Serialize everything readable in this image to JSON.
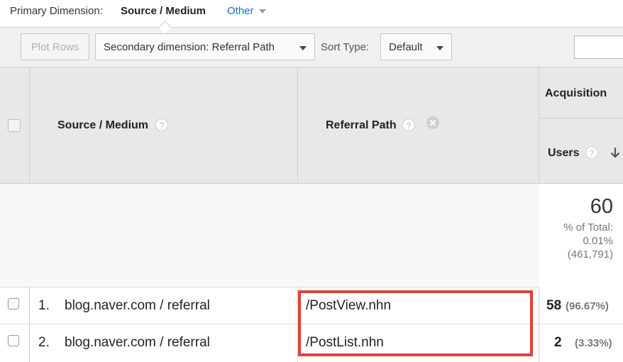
{
  "primary_dimension": {
    "label": "Primary Dimension:",
    "value": "Source / Medium",
    "other": "Other"
  },
  "toolbar": {
    "plot_rows": "Plot Rows",
    "secondary_dimension": "Secondary dimension: Referral Path",
    "sort_type_label": "Sort Type:",
    "sort_type_value": "Default",
    "search_value": ""
  },
  "table": {
    "headers": {
      "source_medium": "Source / Medium",
      "referral_path": "Referral Path",
      "acquisition": "Acquisition",
      "users": "Users",
      "help": "?"
    },
    "totals": {
      "users": "60",
      "pct_of_total_label": "% of Total:",
      "pct_of_total_value": "0.01%",
      "total_value": "(461,791)"
    },
    "rows": [
      {
        "index": "1.",
        "source_medium": "blog.naver.com / referral",
        "referral_path": "/PostView.nhn",
        "users": "58",
        "users_pct": "(96.67%)"
      },
      {
        "index": "2.",
        "source_medium": "blog.naver.com / referral",
        "referral_path": "/PostList.nhn",
        "users": "2",
        "users_pct": "(3.33%)"
      }
    ]
  },
  "colors": {
    "accent_link": "#1a66c9",
    "highlight": "#e0403c",
    "header_bg": "#e8e8e8",
    "toolbar_bg": "#f1f1f1"
  },
  "icons": [
    "help-icon",
    "remove-dimension-icon",
    "sort-down-arrow-icon",
    "dropdown-caret-icon"
  ]
}
